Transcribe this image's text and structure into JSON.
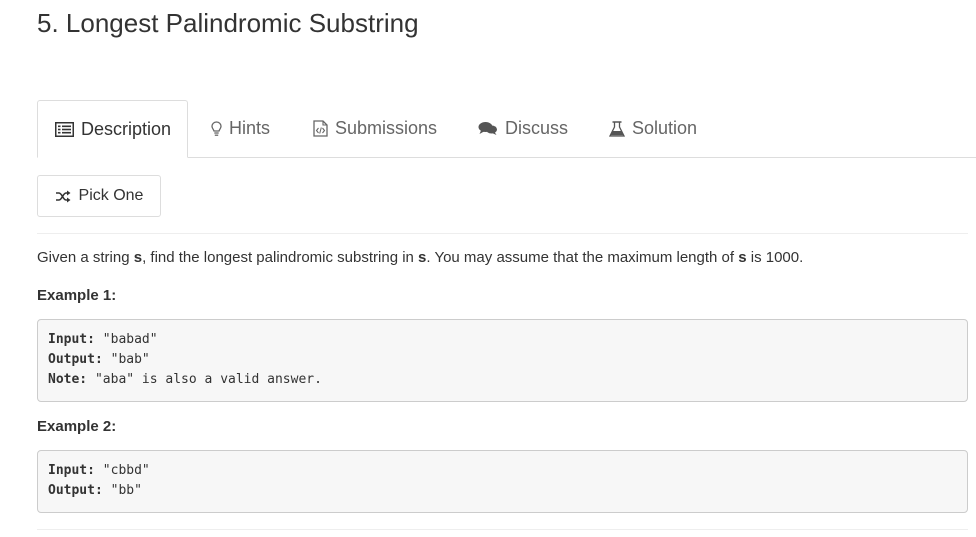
{
  "title": "5. Longest Palindromic Substring",
  "tabs": [
    {
      "label": "Description",
      "icon": "list-icon",
      "active": true
    },
    {
      "label": "Hints",
      "icon": "lightbulb-icon"
    },
    {
      "label": "Submissions",
      "icon": "code-file-icon"
    },
    {
      "label": "Discuss",
      "icon": "chat-bubbles-icon"
    },
    {
      "label": "Solution",
      "icon": "flask-icon"
    }
  ],
  "pick_one": {
    "label": "Pick One",
    "icon": "shuffle-icon"
  },
  "description": {
    "p1": "Given a string ",
    "s1": "s",
    "p2": ", find the longest palindromic substring in ",
    "s2": "s",
    "p3": ". You may assume that the maximum length of ",
    "s3": "s",
    "p4": " is 1000."
  },
  "examples": [
    {
      "title": "Example 1:",
      "lines": [
        {
          "key": "Input:",
          "value": " \"babad\""
        },
        {
          "key": "Output:",
          "value": " \"bab\""
        },
        {
          "key": "Note:",
          "value": " \"aba\" is also a valid answer."
        }
      ]
    },
    {
      "title": "Example 2:",
      "lines": [
        {
          "key": "Input:",
          "value": " \"cbbd\""
        },
        {
          "key": "Output:",
          "value": " \"bb\""
        }
      ]
    }
  ]
}
